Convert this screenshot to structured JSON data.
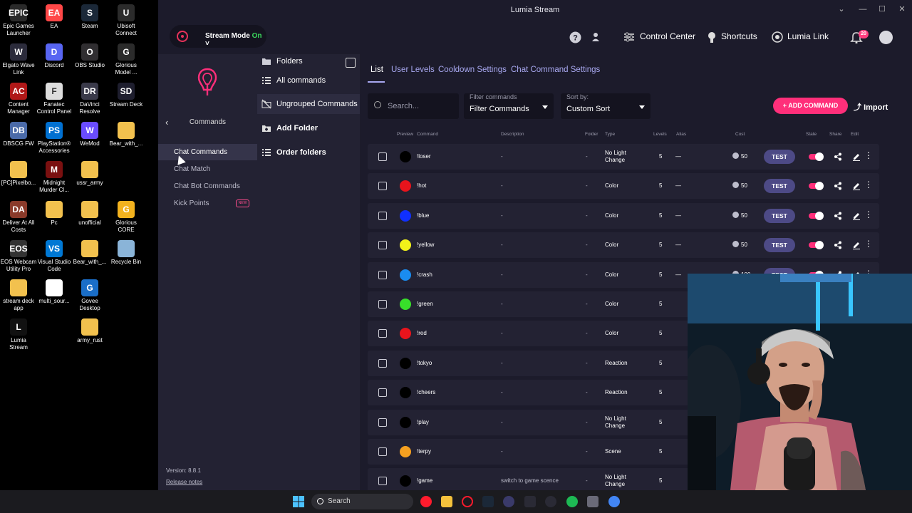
{
  "desktop": {
    "icons": [
      {
        "label": "Epic Games\nLauncher",
        "glyph": "EPIC",
        "color": "#2a2a2a"
      },
      {
        "label": "EA",
        "glyph": "EA",
        "color": "#ff4747"
      },
      {
        "label": "Steam",
        "glyph": "S",
        "color": "#1b2838"
      },
      {
        "label": "Ubisoft\nConnect",
        "glyph": "U",
        "color": "#2b2b2b"
      },
      {
        "label": "Elgato Wave\nLink",
        "glyph": "W",
        "color": "#2b2b3b"
      },
      {
        "label": "Discord",
        "glyph": "D",
        "color": "#5865f2"
      },
      {
        "label": "OBS Studio",
        "glyph": "O",
        "color": "#302e31"
      },
      {
        "label": "Glorious\nModel ...",
        "glyph": "G",
        "color": "#2b2b2b"
      },
      {
        "label": "Content\nManager",
        "glyph": "AC",
        "color": "#b01818"
      },
      {
        "label": "Fanatec\nControl Panel",
        "glyph": "F",
        "color": "#dddddd"
      },
      {
        "label": "DaVinci\nResolve",
        "glyph": "DR",
        "color": "#3a3a4a"
      },
      {
        "label": "Stream Deck",
        "glyph": "SD",
        "color": "#1e1e2e"
      },
      {
        "label": "DBSCG FW",
        "glyph": "DB",
        "color": "#4a6aa8"
      },
      {
        "label": "PlayStation®\nAccessories",
        "glyph": "PS",
        "color": "#0070d1"
      },
      {
        "label": "WeMod",
        "glyph": "W",
        "color": "#6a4cff"
      },
      {
        "label": "Bear_with_...",
        "glyph": "",
        "color": "#f2c14e"
      },
      {
        "label": "[PC]Pixelbo...",
        "glyph": "",
        "color": "#f2c14e"
      },
      {
        "label": "Midnight\nMurder Cl...",
        "glyph": "M",
        "color": "#7a1010"
      },
      {
        "label": "ussr_army",
        "glyph": "",
        "color": "#f2c14e"
      },
      {
        "label": "",
        "glyph": "",
        "color": "#000000"
      },
      {
        "label": "Deliver At All\nCosts",
        "glyph": "DA",
        "color": "#8a3a2a"
      },
      {
        "label": "Pc",
        "glyph": "",
        "color": "#f2c14e"
      },
      {
        "label": "unofficial",
        "glyph": "",
        "color": "#f2c14e"
      },
      {
        "label": "Glorious\nCORE",
        "glyph": "G",
        "color": "#f2b21e"
      },
      {
        "label": "EOS Webcam\nUtility Pro",
        "glyph": "EOS",
        "color": "#333333"
      },
      {
        "label": "Visual Studio\nCode",
        "glyph": "VS",
        "color": "#0078d4"
      },
      {
        "label": "Bear_with_...",
        "glyph": "",
        "color": "#f2c14e"
      },
      {
        "label": "Recycle Bin",
        "glyph": "",
        "color": "#8ab4d8"
      },
      {
        "label": "stream deck\napp",
        "glyph": "",
        "color": "#f2c14e"
      },
      {
        "label": "multi_sour...",
        "glyph": "",
        "color": "#ffffff"
      },
      {
        "label": "Govee\nDesktop",
        "glyph": "G",
        "color": "#1a6ec8"
      },
      {
        "label": "",
        "glyph": "",
        "color": "#000000"
      },
      {
        "label": "Lumia\nStream",
        "glyph": "L",
        "color": "#111111"
      },
      {
        "label": "",
        "glyph": "",
        "color": "#000000"
      },
      {
        "label": "army_rust",
        "glyph": "",
        "color": "#f2c14e"
      }
    ]
  },
  "window": {
    "title": "Lumia Stream"
  },
  "topbar": {
    "stream_mode_label": "Stream Mode",
    "stream_mode_state": "On",
    "control_center": "Control Center",
    "shortcuts": "Shortcuts",
    "lumia_link": "Lumia Link",
    "notification_count": "20"
  },
  "sidebar": {
    "title": "Commands",
    "items": [
      "Chat Commands",
      "Chat Match",
      "Chat Bot Commands",
      "Kick Points"
    ],
    "new_badge": "NEW",
    "version": "Version: 8.8.1",
    "release_notes": "Release notes"
  },
  "folders": {
    "title": "Folders",
    "all": "All commands",
    "ungrouped": "Ungrouped Commands",
    "add": "Add Folder",
    "order": "Order folders"
  },
  "main": {
    "tabs": [
      "List",
      "User Levels",
      "Cooldown Settings",
      "Chat Command Settings"
    ],
    "search_placeholder": "Search...",
    "filter_label": "Filter commands",
    "filter_value": "Filter Commands",
    "sort_label": "Sort by:",
    "sort_value": "Custom Sort",
    "add_command": "ADD COMMAND",
    "import": "Import",
    "headers": [
      "Preview",
      "Command",
      "Description",
      "Folder",
      "Type",
      "Levels",
      "Alias",
      "Cost",
      "State",
      "Share",
      "Edit"
    ],
    "rows": [
      {
        "cmd": "!loser",
        "desc": "-",
        "folder": "-",
        "type": "No Light Change",
        "level": "5",
        "alias": "—",
        "cost": "50",
        "color": "#000000",
        "test": "TEST"
      },
      {
        "cmd": "!hot",
        "desc": "-",
        "folder": "-",
        "type": "Color",
        "level": "5",
        "alias": "—",
        "cost": "50",
        "color": "#e8141c",
        "test": "TEST"
      },
      {
        "cmd": "!blue",
        "desc": "-",
        "folder": "-",
        "type": "Color",
        "level": "5",
        "alias": "—",
        "cost": "50",
        "color": "#1030ff",
        "test": "TEST"
      },
      {
        "cmd": "!yellow",
        "desc": "-",
        "folder": "-",
        "type": "Color",
        "level": "5",
        "alias": "—",
        "cost": "50",
        "color": "#f2f21a",
        "test": "TEST"
      },
      {
        "cmd": "!crash",
        "desc": "-",
        "folder": "-",
        "type": "Color",
        "level": "5",
        "alias": "—",
        "cost": "100",
        "color": "#1a8cf0",
        "test": "TEST"
      },
      {
        "cmd": "!green",
        "desc": "-",
        "folder": "-",
        "type": "Color",
        "level": "5",
        "alias": "",
        "cost": "",
        "color": "#38e02a",
        "test": ""
      },
      {
        "cmd": "!red",
        "desc": "-",
        "folder": "-",
        "type": "Color",
        "level": "5",
        "alias": "",
        "cost": "",
        "color": "#e8141c",
        "test": ""
      },
      {
        "cmd": "!tokyo",
        "desc": "-",
        "folder": "-",
        "type": "Reaction",
        "level": "5",
        "alias": "",
        "cost": "",
        "color": "#000000",
        "test": ""
      },
      {
        "cmd": "!cheers",
        "desc": "-",
        "folder": "-",
        "type": "Reaction",
        "level": "5",
        "alias": "",
        "cost": "",
        "color": "#000000",
        "test": ""
      },
      {
        "cmd": "!play",
        "desc": "-",
        "folder": "-",
        "type": "No Light Change",
        "level": "5",
        "alias": "",
        "cost": "",
        "color": "#000000",
        "test": ""
      },
      {
        "cmd": "!terpy",
        "desc": "-",
        "folder": "-",
        "type": "Scene",
        "level": "5",
        "alias": "",
        "cost": "",
        "color": "#f5a020",
        "test": ""
      },
      {
        "cmd": "!game",
        "desc": "switch to game scence",
        "folder": "-",
        "type": "No Light Change",
        "level": "5",
        "alias": "",
        "cost": "",
        "color": "#000000",
        "test": ""
      }
    ]
  },
  "taskbar": {
    "search_label": "Search"
  },
  "colors": {
    "accent": "#ff2f7a",
    "test_button": "#4d4a86",
    "tab_link": "#a8a8f0",
    "panel": "#232233",
    "background": "#1c1b2b"
  }
}
